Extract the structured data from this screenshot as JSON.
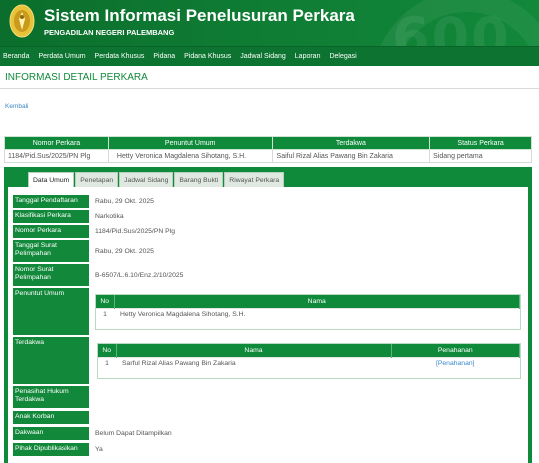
{
  "header": {
    "title": "Sistem Informasi Penelusuran Perkara",
    "subtitle": "PENGADILAN NEGERI PALEMBANG",
    "watermark": "600",
    "logo_icon": "court-emblem-icon",
    "brand_color": "#0f8a3a"
  },
  "nav": {
    "items": [
      "Beranda",
      "Perdata Umum",
      "Perdata Khusus",
      "Pidana",
      "Pidana Khusus",
      "Jadwal Sidang",
      "Laporan",
      "Delegasi"
    ]
  },
  "page": {
    "title": "INFORMASI DETAIL PERKARA",
    "back_label": "Kembali"
  },
  "case_summary": {
    "headers": [
      "Nomor Perkara",
      "Penuntut Umum",
      "Terdakwa",
      "Status Perkara"
    ],
    "row": [
      "1184/Pid.Sus/2025/PN Plg",
      "Hetty Veronica Magdalena Sihotang, S.H.",
      "Saiful Rizal Alias Pawang Bin Zakaria",
      "Sidang pertama"
    ]
  },
  "tabs": [
    "Data Umum",
    "Penetapan",
    "Jadwal Sidang",
    "Barang Bukti",
    "Riwayat Perkara"
  ],
  "details": {
    "tanggal_pendaftaran": {
      "label": "Tanggal Pendaftaran",
      "value": "Rabu, 29 Okt. 2025"
    },
    "klasifikasi": {
      "label": "Klasifikasi Perkara",
      "value": "Narkotika"
    },
    "nomor_perkara": {
      "label": "Nomor Perkara",
      "value": "1184/Pid.Sus/2025/PN Plg"
    },
    "tanggal_surat": {
      "label": "Tanggal Surat Pelimpahan",
      "value": "Rabu, 29 Okt. 2025"
    },
    "nomor_surat": {
      "label": "Nomor Surat Pelimpahan",
      "value": "B-6507/L.6.10/Enz.2/10/2025"
    },
    "penuntut_umum": {
      "label": "Penuntut Umum"
    },
    "terdakwa": {
      "label": "Terdakwa"
    },
    "penasihat_hukum": {
      "label": "Penasihat Hukum Terdakwa"
    },
    "anak_korban": {
      "label": "Anak Korban"
    },
    "dakwaan": {
      "label": "Dakwaan",
      "value": "Belum Dapat Ditampilkan"
    },
    "pihak_dipublikasikan": {
      "label": "Pihak Dipublikasikan",
      "value": "Ya"
    }
  },
  "penuntut_table": {
    "headers": [
      "No",
      "Nama"
    ],
    "rows": [
      {
        "no": "1",
        "nama": "Hetty Veronica Magdalena Sihotang, S.H."
      }
    ]
  },
  "terdakwa_table": {
    "headers": [
      "No",
      "Nama",
      "Penahanan"
    ],
    "rows": [
      {
        "no": "1",
        "nama": "Sarful Rizal Alias Pawang Bin Zakaria",
        "penahanan": "[Penahanan]"
      }
    ]
  }
}
